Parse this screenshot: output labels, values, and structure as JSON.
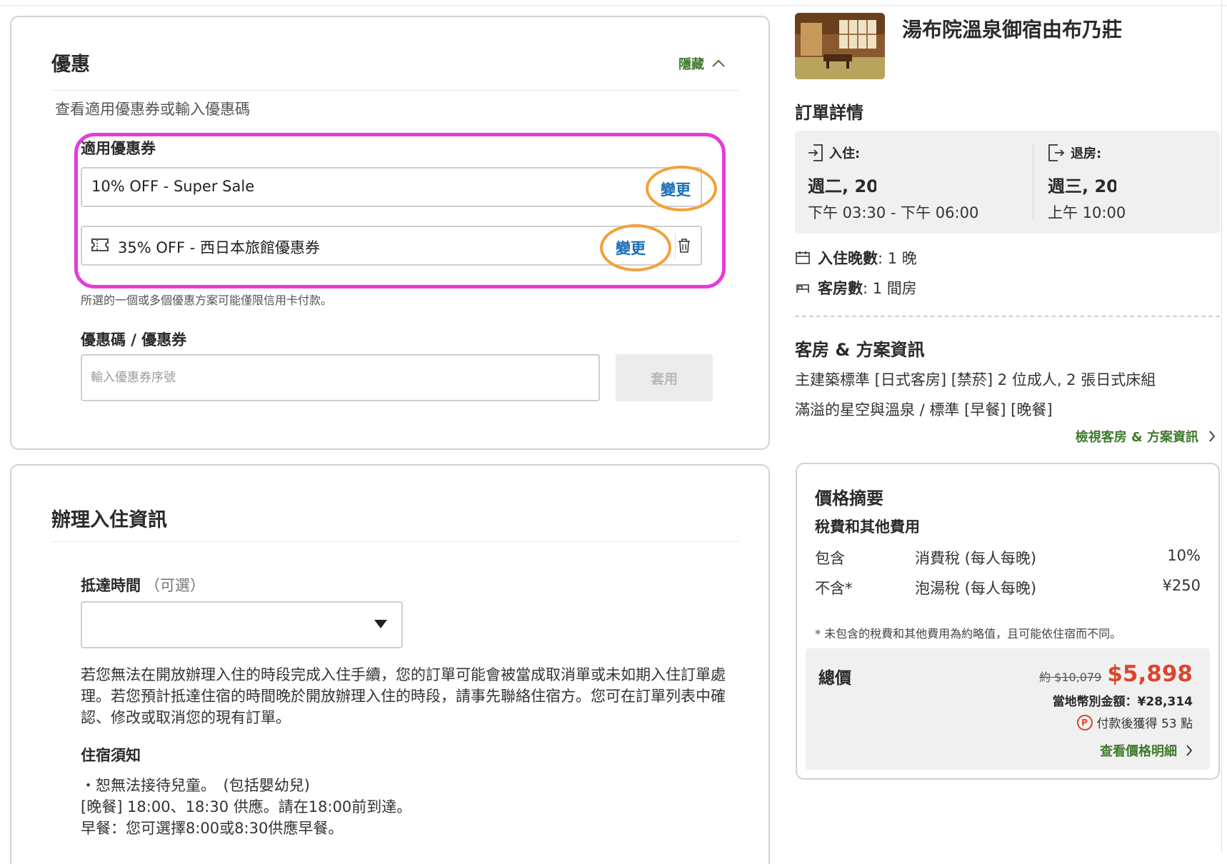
{
  "discount": {
    "title": "優惠",
    "hide_label": "隱藏",
    "subtitle": "查看適用優惠券或輸入優惠碼",
    "applicable_label": "適用優惠券",
    "coupons": [
      {
        "text": "10% OFF - Super Sale",
        "change_label": "變更"
      },
      {
        "text": "35% OFF - 西日本旅館優惠券",
        "change_label": "變更"
      }
    ],
    "payment_note": "所選的一個或多個優惠方案可能僅限信用卡付款。",
    "code_label": "優惠碼 / 優惠券",
    "code_placeholder": "輸入優惠券序號",
    "apply_label": "套用"
  },
  "checkin": {
    "title": "辦理入住資訊",
    "arrival_label": "抵達時間",
    "arrival_optional": "（可選）",
    "arrival_value": "",
    "paragraph": "若您無法在開放辦理入住的時段完成入住手續，您的訂單可能會被當成取消單或未如期入住訂單處理。若您預計抵達住宿的時間晚於開放辦理入住的時段，請事先聯絡住宿方。您可在訂單列表中確認、修改或取消您的現有訂單。",
    "notice_title": "住宿須知",
    "notice_lines": [
      "・恕無法接待兒童。　(包括嬰幼兒)",
      "[晚餐] 18:00、18:30 供應。請在18:00前到達。",
      "早餐：您可選擇8:00或8:30供應早餐。"
    ]
  },
  "hotel": {
    "name": "湯布院溫泉御宿由布乃莊",
    "order_title": "訂單詳情",
    "checkin_head": "入住:",
    "checkin_day": "週二, 20",
    "checkin_time": "下午 03:30 - 下午 06:00",
    "checkout_head": "退房:",
    "checkout_day": "週三, 20",
    "checkout_time": "上午 10:00",
    "nights_label": "入住晚數",
    "nights_value": ": 1 晚",
    "rooms_label": "客房數",
    "rooms_value": ": 1 間房",
    "room_title": "客房 & 方案資訊",
    "room_line1": "主建築標準 [日式客房] [禁菸] 2 位成人, 2 張日式床組",
    "room_line2": "滿溢的星空與溫泉 / 標準 [早餐] [晚餐]",
    "view_room_link": "檢視客房 & 方案資訊"
  },
  "price": {
    "title": "價格摘要",
    "subtitle": "稅費和其他費用",
    "fees": [
      {
        "status": "包含",
        "name": "消費稅 (每人每晚)",
        "amount": "10%"
      },
      {
        "status": "不含*",
        "name": "泡湯稅 (每人每晚)",
        "amount": "¥250"
      }
    ],
    "note": "* 未包含的稅費和其他費用為約略值，且可能依住宿而不同。",
    "total_label": "總價",
    "original_price": "約 $10,079",
    "final_price": "$5,898",
    "local_amount": "當地幣別金額：¥28,314",
    "points_badge": "P",
    "points_text": "付款後獲得 53 點",
    "detail_link": "查看價格明細"
  },
  "colors": {
    "accent_green": "#3f7a2c",
    "link_blue": "#1a6fb8",
    "price_red": "#d8472f",
    "annotation_pink": "#e83ad9",
    "annotation_orange": "#f2a13a"
  }
}
